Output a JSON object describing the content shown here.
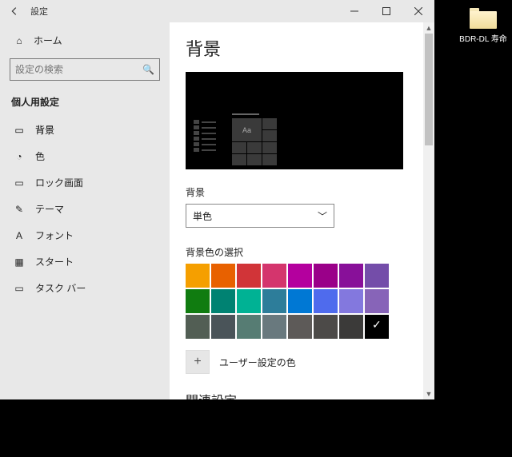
{
  "window": {
    "title": "設定"
  },
  "sidebar": {
    "home": "ホーム",
    "search_placeholder": "設定の検索",
    "section": "個人用設定",
    "items": [
      {
        "icon": "▭",
        "label": "背景"
      },
      {
        "icon": "◔",
        "label": "色"
      },
      {
        "icon": "▭",
        "label": "ロック画面"
      },
      {
        "icon": "✎",
        "label": "テーマ"
      },
      {
        "icon": "A",
        "label": "フォント"
      },
      {
        "icon": "▦",
        "label": "スタート"
      },
      {
        "icon": "▭",
        "label": "タスク バー"
      }
    ]
  },
  "content": {
    "page_title": "背景",
    "preview_aa": "Aa",
    "dropdown_label": "背景",
    "dropdown_value": "単色",
    "swatch_label": "背景色の選択",
    "colors_row1": [
      "#f59f00",
      "#e86100",
      "#d13438",
      "#d4356d",
      "#b4009e",
      "#9a0089",
      "#881099",
      "#744da9"
    ],
    "colors_row2": [
      "#107c10",
      "#008272",
      "#00b294",
      "#2d7d9a",
      "#0078d4",
      "#4f6bed",
      "#8378de",
      "#8764b8"
    ],
    "colors_row3": [
      "#525e54",
      "#4a5459",
      "#567c73",
      "#69797e",
      "#5d5a58",
      "#4c4a48",
      "#3b3a39",
      "#000000"
    ],
    "selected_color_index": 23,
    "custom_color": "ユーザー設定の色",
    "related": "関連設定"
  },
  "desktop": {
    "icon_label": "BDR-DL 寿命"
  }
}
